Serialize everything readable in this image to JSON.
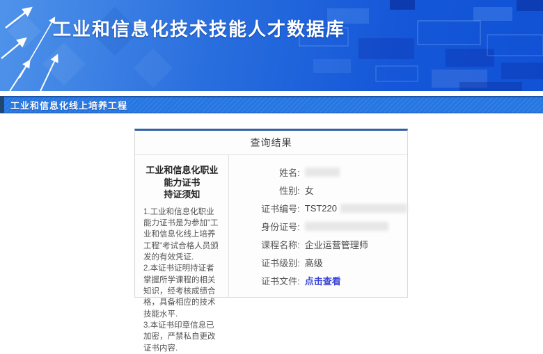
{
  "header": {
    "title": "工业和信息化技术技能人才数据库"
  },
  "subheader": {
    "title": "工业和信息化线上培养工程"
  },
  "panel": {
    "title": "查询结果",
    "notice": {
      "heading_line1": "工业和信息化职业能力证书",
      "heading_line2": "持证须知",
      "items": [
        "1.工业和信息化职业能力证书是为参加\"工业和信息化线上培养工程\"考试合格人员颁发的有效凭证.",
        "2.本证书证明持证者掌握所学课程的相关知识，经考核成绩合格，具备相应的技术技能水平.",
        "3.本证书印章信息已加密，严禁私自更改证书内容."
      ]
    },
    "fields": [
      {
        "name": "name",
        "label": "姓名:",
        "value": "",
        "redacted_width": 50
      },
      {
        "name": "gender",
        "label": "性别:",
        "value": "女"
      },
      {
        "name": "cert-no",
        "label": "证书编号:",
        "value": "TST220",
        "redacted_width": 96
      },
      {
        "name": "id-no",
        "label": "身份证号:",
        "value": "",
        "redacted_width": 120
      },
      {
        "name": "course",
        "label": "课程名称:",
        "value": "企业运营管理师"
      },
      {
        "name": "level",
        "label": "证书级别:",
        "value": "高级"
      },
      {
        "name": "file",
        "label": "证书文件:",
        "value": "点击查看",
        "link": true
      }
    ]
  },
  "icons": {
    "banner_arrows": "growth-arrows-decoration",
    "banner_pattern": "tech-squares-decoration"
  },
  "colors": {
    "banner_gradient_start": "#4f93ea",
    "banner_gradient_end": "#1152d6",
    "subbar_blue": "#2677e2",
    "subbar_edge_navy": "#204672",
    "panel_top_border": "#2e5fa8",
    "link_blue": "#3b45d6",
    "text_dark": "#444444",
    "text_muted": "#555555"
  }
}
